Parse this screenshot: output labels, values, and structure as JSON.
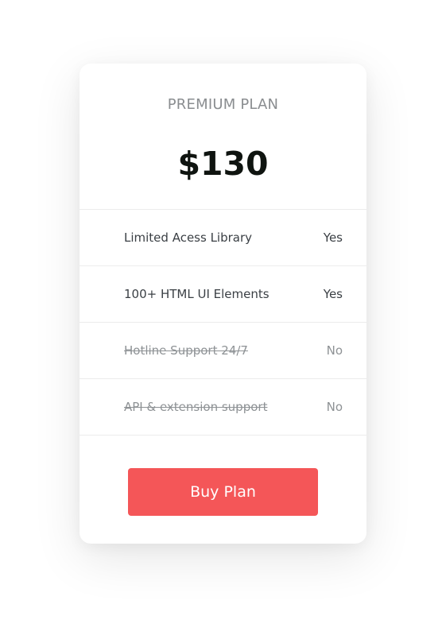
{
  "plan": {
    "name": "PREMIUM PLAN",
    "price": "$130"
  },
  "features": [
    {
      "label": "Limited Acess Library",
      "value": "Yes",
      "included": true
    },
    {
      "label": "100+ HTML UI Elements",
      "value": "Yes",
      "included": true
    },
    {
      "label": "Hotline Support 24/7",
      "value": "No",
      "included": false
    },
    {
      "label": "API & extension support",
      "value": "No",
      "included": false
    }
  ],
  "button": {
    "label": "Buy Plan",
    "color": "#f45658"
  }
}
